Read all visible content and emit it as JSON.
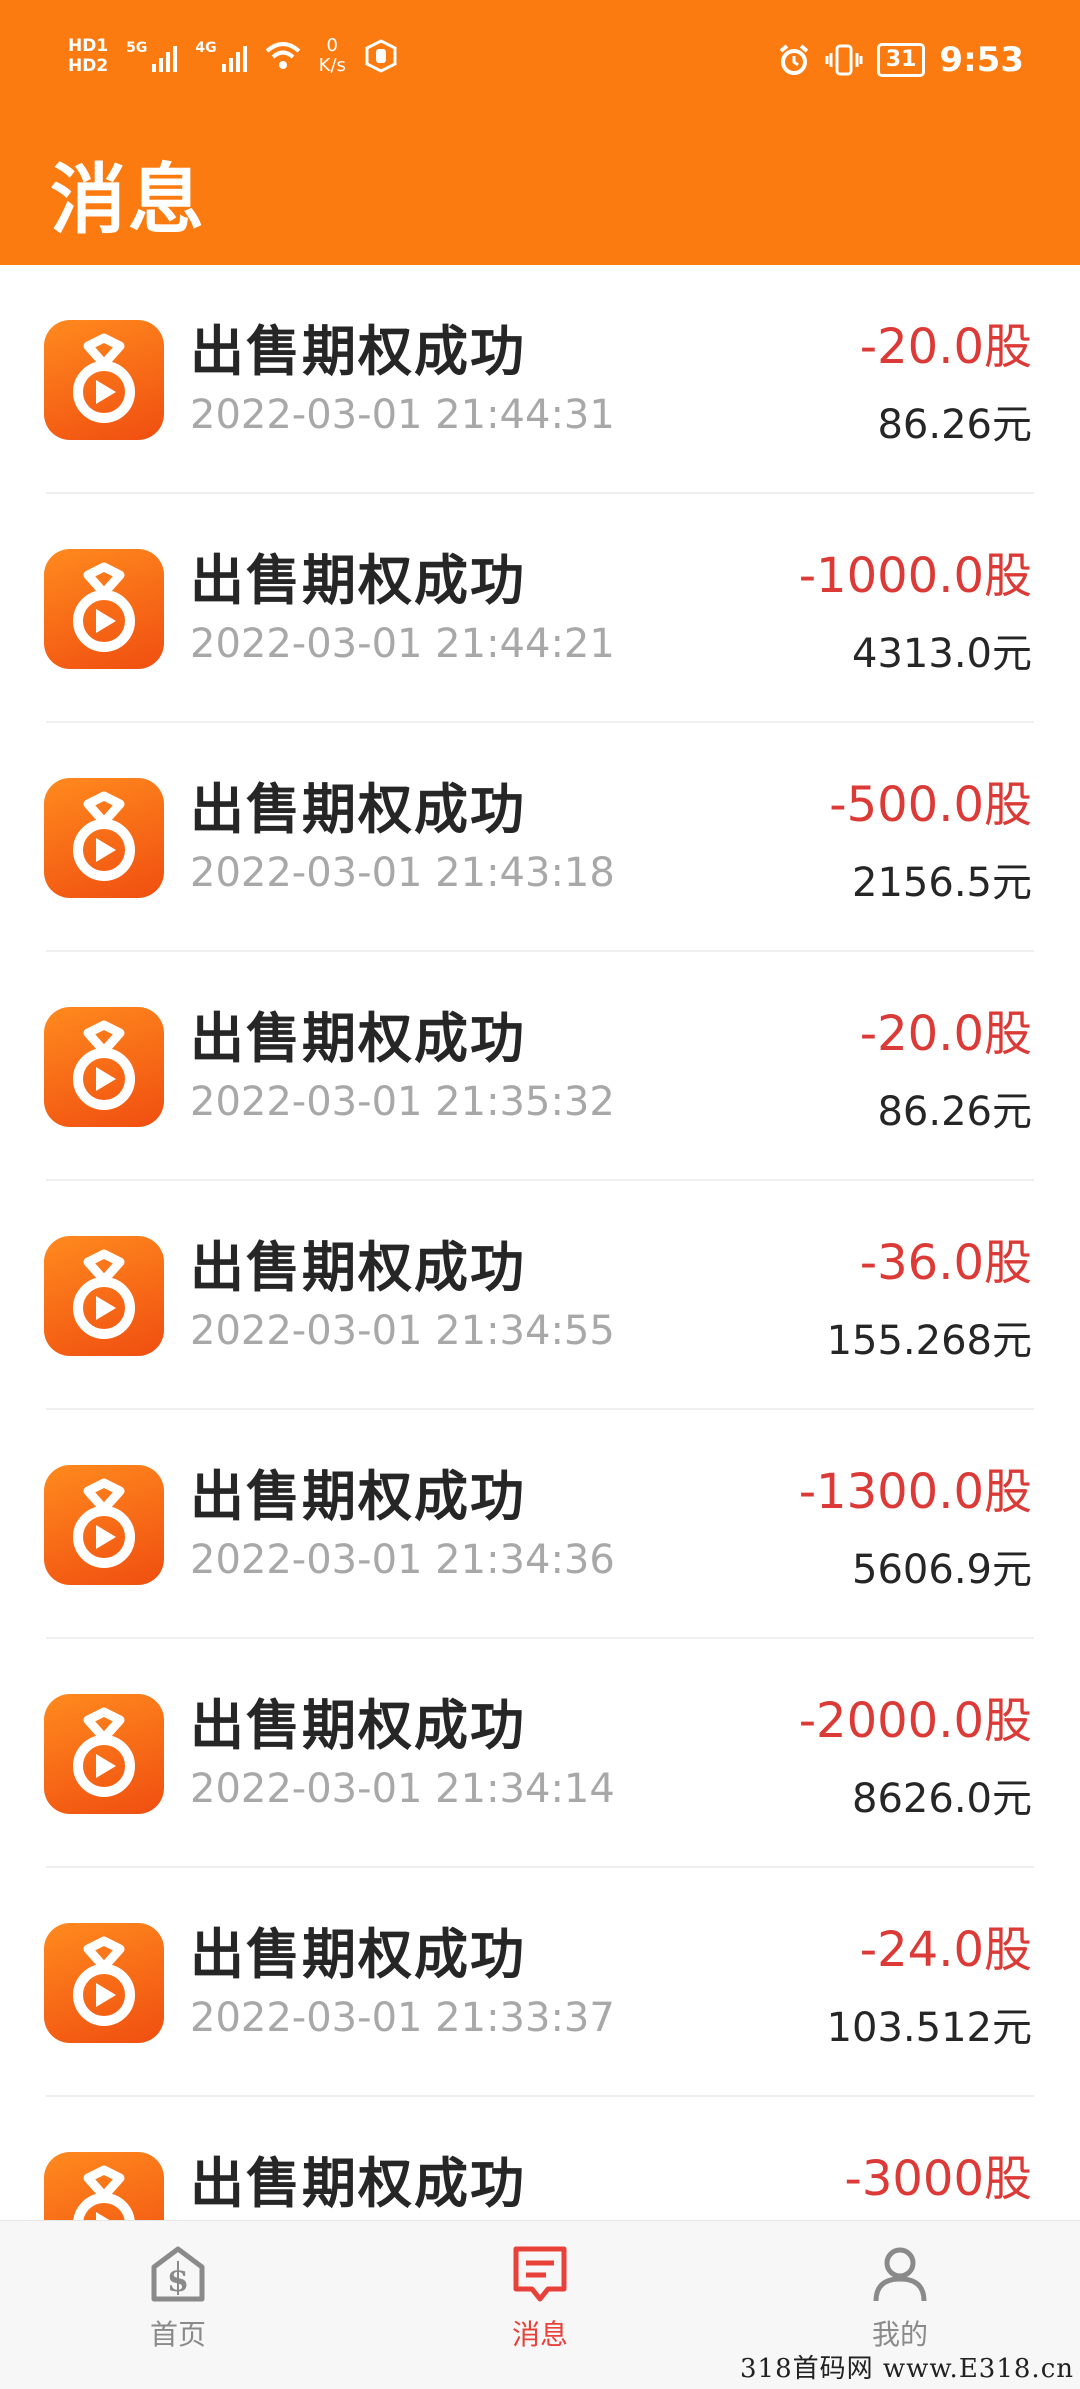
{
  "status_bar": {
    "sim1": "HD1",
    "sim2": "HD2",
    "net1": "5G",
    "net2": "4G",
    "speed_value": "0",
    "speed_unit": "K/s",
    "battery": "31",
    "time": "9:53"
  },
  "page_title": "消息",
  "items": [
    {
      "title": "出售期权成功",
      "time": "2022-03-01 21:44:31",
      "amount": "-20.0股",
      "value": "86.26元"
    },
    {
      "title": "出售期权成功",
      "time": "2022-03-01 21:44:21",
      "amount": "-1000.0股",
      "value": "4313.0元"
    },
    {
      "title": "出售期权成功",
      "time": "2022-03-01 21:43:18",
      "amount": "-500.0股",
      "value": "2156.5元"
    },
    {
      "title": "出售期权成功",
      "time": "2022-03-01 21:35:32",
      "amount": "-20.0股",
      "value": "86.26元"
    },
    {
      "title": "出售期权成功",
      "time": "2022-03-01 21:34:55",
      "amount": "-36.0股",
      "value": "155.268元"
    },
    {
      "title": "出售期权成功",
      "time": "2022-03-01 21:34:36",
      "amount": "-1300.0股",
      "value": "5606.9元"
    },
    {
      "title": "出售期权成功",
      "time": "2022-03-01 21:34:14",
      "amount": "-2000.0股",
      "value": "8626.0元"
    },
    {
      "title": "出售期权成功",
      "time": "2022-03-01 21:33:37",
      "amount": "-24.0股",
      "value": "103.512元"
    },
    {
      "title": "出售期权成功",
      "time": "",
      "amount": "-3000股",
      "value": ""
    }
  ],
  "tabs": [
    {
      "label": "首页",
      "icon": "home-dollar-icon",
      "active": false
    },
    {
      "label": "消息",
      "icon": "message-icon",
      "active": true
    },
    {
      "label": "我的",
      "icon": "person-icon",
      "active": false
    }
  ],
  "colors": {
    "header": "#FB7B10",
    "amount_red": "#DB3A36",
    "tab_active": "#E8413A",
    "tab_inactive": "#8A8A8A"
  },
  "watermark": "318首码网 www.E318.cn"
}
